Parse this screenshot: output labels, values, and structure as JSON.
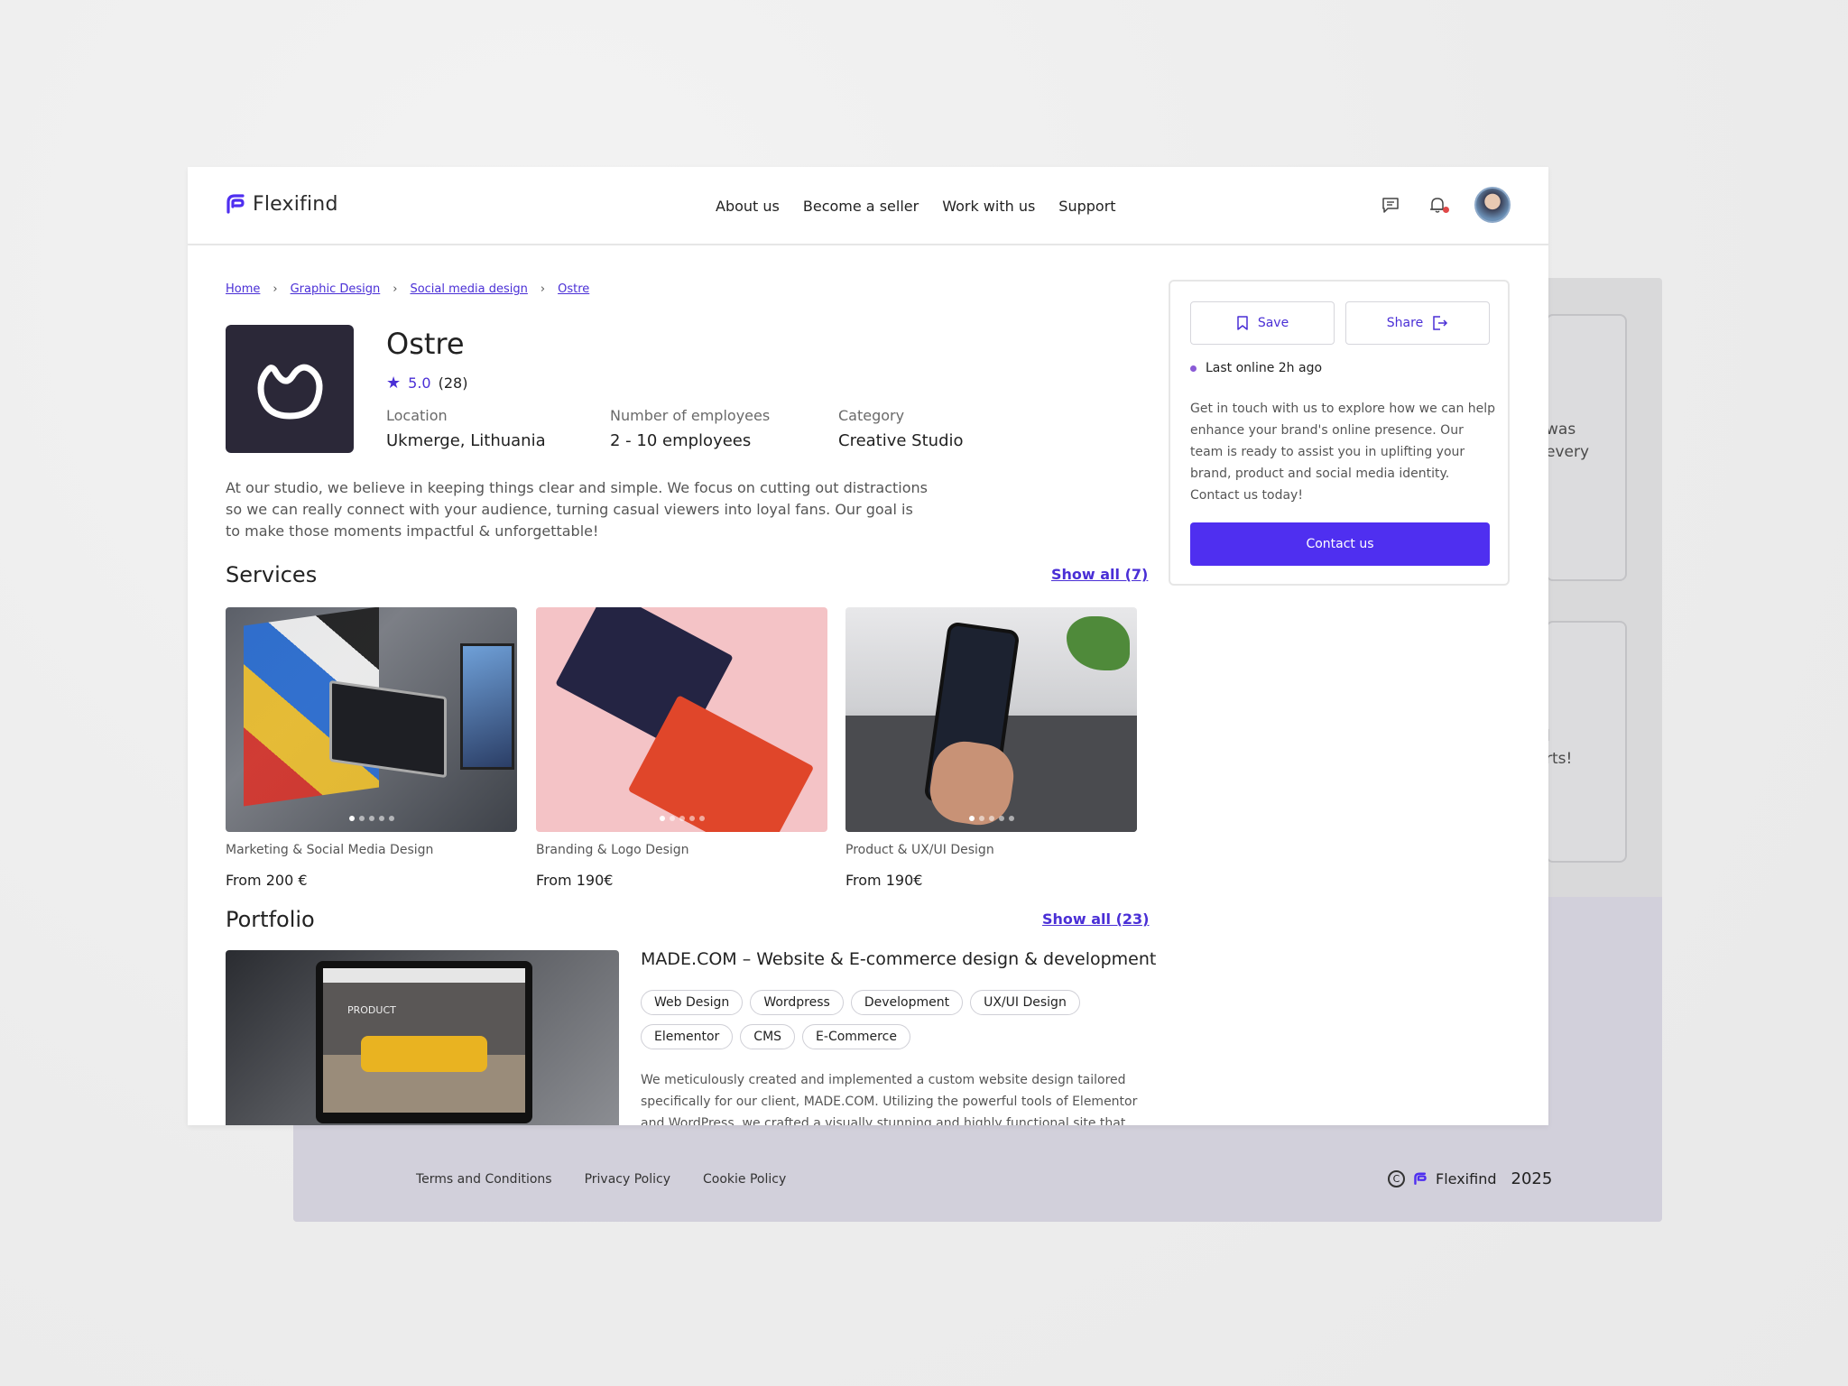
{
  "brand": {
    "name": "Flexifind",
    "accent": "#4f2ff0",
    "link_color": "#4a2fd6"
  },
  "nav": {
    "items": [
      "About us",
      "Become a seller",
      "Work with us",
      "Support"
    ],
    "icons": [
      "chat-icon",
      "bell-icon",
      "avatar"
    ]
  },
  "breadcrumb": [
    "Home",
    "Graphic Design",
    "Social media design",
    "Ostre"
  ],
  "studio": {
    "name": "Ostre",
    "rating": "5.0",
    "reviews": "(28)",
    "location_label": "Location",
    "location": "Ukmerge, Lithuania",
    "employees_label": "Number of employees",
    "employees": "2 - 10 employees",
    "category_label": "Category",
    "category": "Creative Studio",
    "description": "At our studio, we believe in keeping things clear and simple. We focus on cutting out distractions so we can really connect with your audience, turning casual viewers into loyal fans. Our goal is to make those moments impactful & unforgettable!"
  },
  "services": {
    "title": "Services",
    "show_all": "Show all (7)",
    "items": [
      {
        "category": "Marketing & Social Media Design",
        "price": "From 200 €"
      },
      {
        "category": "Branding & Logo Design",
        "price": "From 190€"
      },
      {
        "category": "Product & UX/UI Design",
        "price": "From 190€"
      }
    ]
  },
  "portfolio": {
    "title": "Portfolio",
    "show_all": "Show all (23)",
    "item_title": "MADE.COM – Website & E-commerce design & development",
    "tags": [
      "Web Design",
      "Wordpress",
      "Development",
      "UX/UI Design",
      "Elementor",
      "CMS",
      "E-Commerce"
    ],
    "description": "We meticulously created and implemented a custom website design tailored specifically for our client, MADE.COM. Utilizing the powerful tools of Elementor and WordPress, we crafted a visually stunning and highly functional site that"
  },
  "panel": {
    "save": "Save",
    "share": "Share",
    "online": "Last online 2h ago",
    "description": "Get in touch with us to explore how we can help enhance your brand's online presence. Our team is ready to assist you in uplifting your brand, product and social media identity. Contact us today!",
    "contact": "Contact us"
  },
  "background": {
    "ghost_text_1": "was\nevery",
    "ghost_text_2": "l\nrts!"
  },
  "footer": {
    "links": [
      "Terms and Conditions",
      "Privacy Policy",
      "Cookie Policy"
    ],
    "brand": "Flexifind",
    "year": "2025",
    "copyright_symbol": "©"
  }
}
